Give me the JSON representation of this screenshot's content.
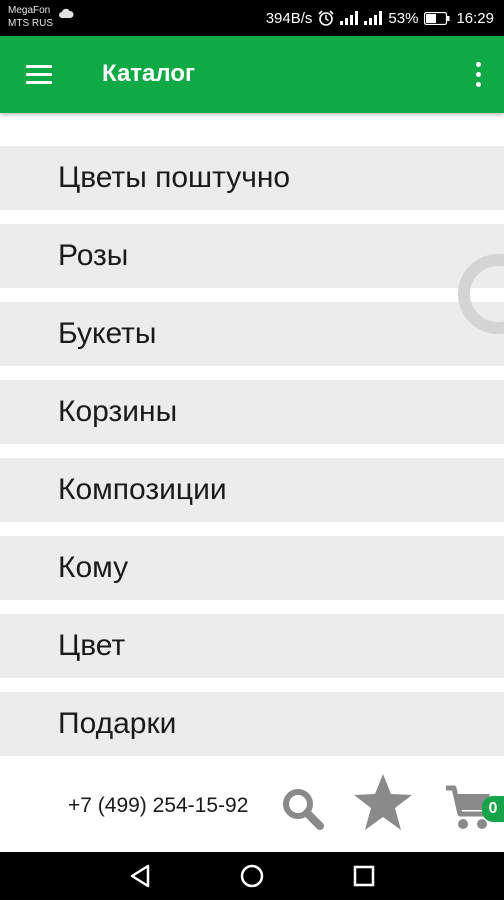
{
  "status_bar": {
    "carrier_1": "MegaFon",
    "carrier_2": "MTS RUS",
    "speed": "394B/s",
    "battery": "53%",
    "time": "16:29"
  },
  "app_bar": {
    "title": "Каталог",
    "color": "#0faa45"
  },
  "categories": [
    {
      "label": "Цветы поштучно"
    },
    {
      "label": "Розы"
    },
    {
      "label": "Букеты"
    },
    {
      "label": "Корзины"
    },
    {
      "label": "Композиции"
    },
    {
      "label": "Кому"
    },
    {
      "label": "Цвет"
    },
    {
      "label": "Подарки"
    }
  ],
  "bottom_bar": {
    "phone": "+7 (499) 254-15-92",
    "cart_count": "0",
    "icons": [
      "search-icon",
      "star-icon",
      "cart-icon"
    ]
  },
  "nav_bar": {
    "icons": [
      "back-icon",
      "home-icon",
      "recents-icon"
    ]
  }
}
